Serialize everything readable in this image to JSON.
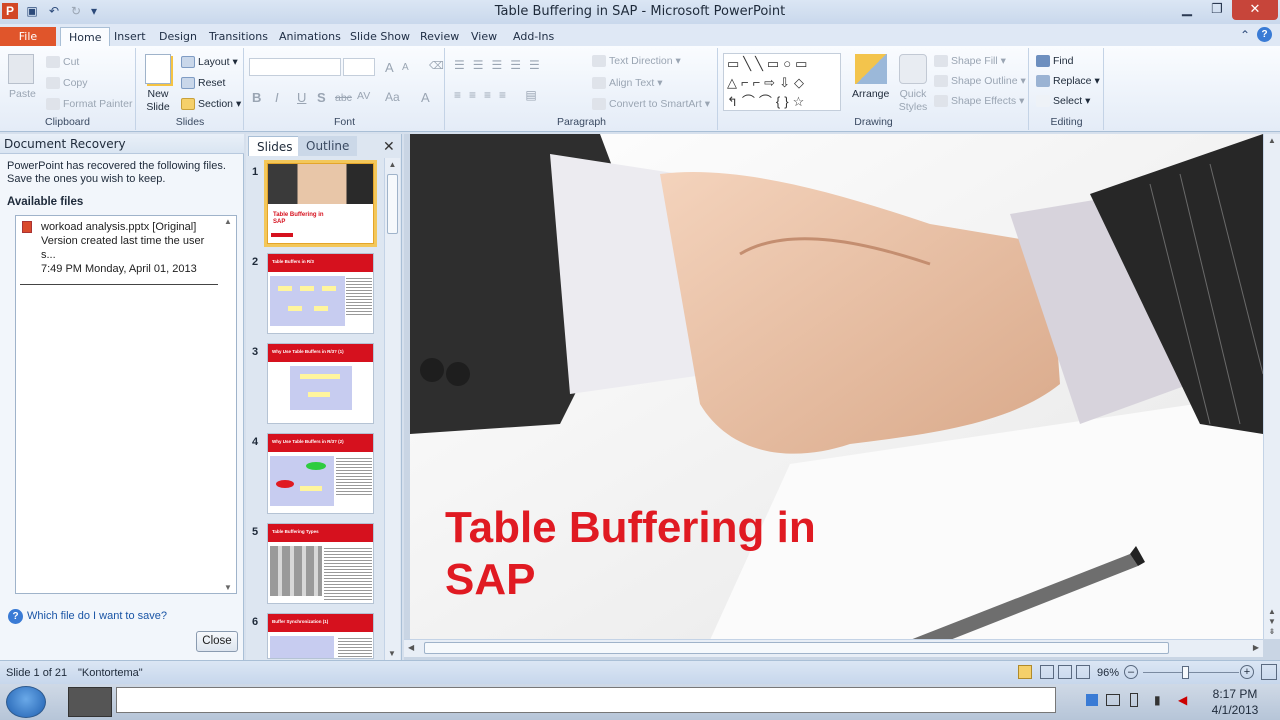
{
  "window": {
    "title": "Table Buffering in SAP - Microsoft PowerPoint"
  },
  "tabs": [
    "File",
    "Home",
    "Insert",
    "Design",
    "Transitions",
    "Animations",
    "Slide Show",
    "Review",
    "View",
    "Add-Ins"
  ],
  "ribbon": {
    "clipboard": {
      "paste": "Paste",
      "cut": "Cut",
      "copy": "Copy",
      "format_painter": "Format Painter",
      "label": "Clipboard"
    },
    "slides": {
      "new_slide": "New Slide",
      "layout": "Layout",
      "reset": "Reset",
      "section": "Section",
      "label": "Slides"
    },
    "font": {
      "label": "Font",
      "bold": "B",
      "italic": "I",
      "underline": "U",
      "shadow": "S",
      "strike": "abc",
      "spacing": "AV",
      "case": "Aa",
      "grow": "A",
      "shrink": "A",
      "color": "A"
    },
    "paragraph": {
      "text_direction": "Text Direction",
      "align_text": "Align Text",
      "smartart": "Convert to SmartArt",
      "label": "Paragraph"
    },
    "drawing": {
      "arrange": "Arrange",
      "quick_styles": "Quick Styles",
      "shape_fill": "Shape Fill",
      "shape_outline": "Shape Outline",
      "shape_effects": "Shape Effects",
      "label": "Drawing"
    },
    "editing": {
      "find": "Find",
      "replace": "Replace",
      "select": "Select",
      "label": "Editing"
    }
  },
  "recovery": {
    "header": "Document Recovery",
    "message": "PowerPoint has recovered the following files. Save the ones you wish to keep.",
    "available": "Available files",
    "file_line1": "workoad analysis.pptx  [Original]",
    "file_line2": "Version created last time the user s...",
    "file_line3": "7:49 PM Monday, April 01, 2013",
    "help": "Which file do I want to save?",
    "close": "Close"
  },
  "pane": {
    "tab_slides": "Slides",
    "tab_outline": "Outline",
    "close": "✕"
  },
  "thumbnails": [
    {
      "num": "1",
      "title": "Table Buffering in SAP"
    },
    {
      "num": "2",
      "title": "Table Buffers in R/3"
    },
    {
      "num": "3",
      "title": "Why Use Table Buffers in R/3? (1)"
    },
    {
      "num": "4",
      "title": "Why Use Table Buffers in R/3? (2)"
    },
    {
      "num": "5",
      "title": "Table Buffering Types"
    },
    {
      "num": "6",
      "title": "Buffer Synchronization (1)"
    }
  ],
  "slide": {
    "title_line1": "Table Buffering in",
    "title_line2": "SAP"
  },
  "status": {
    "slide_info": "Slide 1 of 21",
    "theme": "\"Kontortema\"",
    "zoom": "96%"
  },
  "clock": {
    "time": "8:17 PM",
    "date": "4/1/2013"
  },
  "colors": {
    "accent": "#d6111e",
    "file_tab": "#e0552b"
  }
}
